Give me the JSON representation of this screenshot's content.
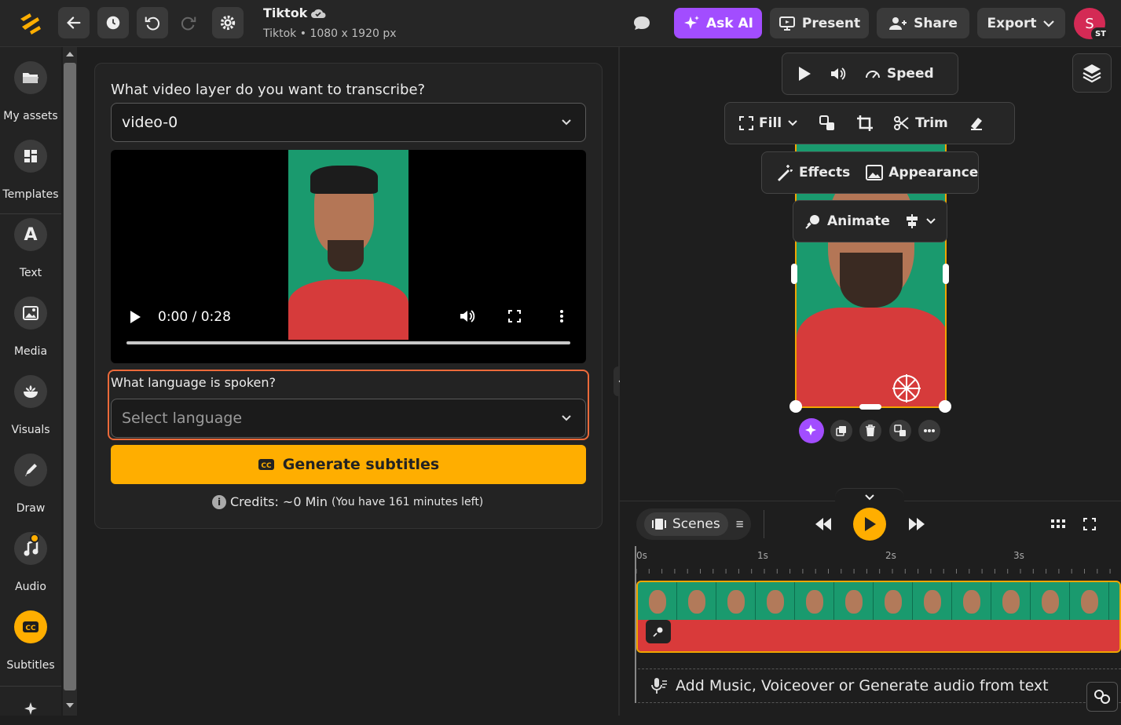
{
  "header": {
    "title": "Tiktok",
    "subtitle": "Tiktok • 1080 x 1920 px",
    "ask_ai": "Ask AI",
    "present": "Present",
    "share": "Share",
    "export": "Export",
    "avatar_initial": "S",
    "avatar_badge": "ST"
  },
  "sidebar": {
    "items": [
      {
        "label": "My assets",
        "icon": "folder-icon"
      },
      {
        "label": "Templates",
        "icon": "templates-icon"
      },
      {
        "label": "Text",
        "icon": "text-icon"
      },
      {
        "label": "Media",
        "icon": "image-icon"
      },
      {
        "label": "Visuals",
        "icon": "visuals-icon"
      },
      {
        "label": "Draw",
        "icon": "pen-icon"
      },
      {
        "label": "Audio",
        "icon": "music-icon"
      },
      {
        "label": "Subtitles",
        "icon": "cc-icon"
      }
    ]
  },
  "subtitles_panel": {
    "layer_question": "What video layer do you want to transcribe?",
    "layer_value": "video-0",
    "video_time": "0:00 / 0:28",
    "language_question": "What language is spoken?",
    "language_placeholder": "Select language",
    "generate": "Generate subtitles",
    "credits": "Credits: ~0 Min",
    "credits_left": "(You have 161 minutes left)"
  },
  "preview_toolbar": {
    "speed": "Speed",
    "fill": "Fill",
    "trim": "Trim",
    "effects": "Effects",
    "appearance": "Appearance",
    "animate": "Animate"
  },
  "timeline": {
    "scenes": "Scenes",
    "ruler": [
      "0s",
      "1s",
      "2s",
      "3s"
    ],
    "audio_prompt": "Add Music, Voiceover or Generate audio from text",
    "frame_count": 13
  },
  "colors": {
    "accent": "#ffae00",
    "ask_ai": "#a24dff",
    "avatar": "#d42a55",
    "highlight_border": "#ec6a3a"
  }
}
